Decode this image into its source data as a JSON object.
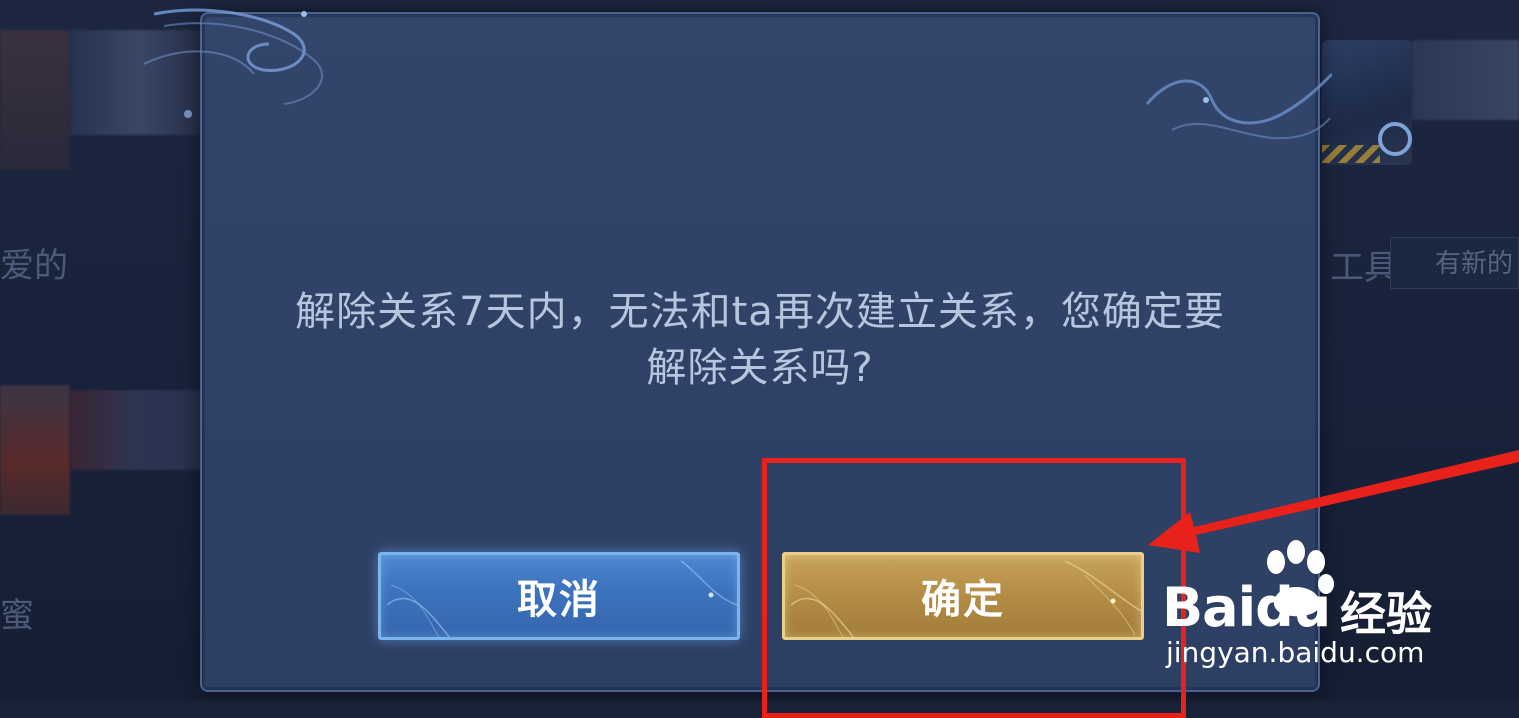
{
  "background": {
    "left_texts": [
      "爱的",
      "蜜"
    ],
    "right_text": "工具",
    "right_badge": "有新的"
  },
  "dialog": {
    "message_line1": "解除关系7天内，无法和ta再次建立关系，您确定要",
    "message_line2": "解除关系吗?",
    "cancel_label": "取消",
    "confirm_label": "确定"
  },
  "watermark": {
    "brand": "Baidu",
    "product": "经验",
    "url": "jingyan.baidu.com"
  },
  "colors": {
    "annotation_red": "#e8211b",
    "cancel_blue": "#3c72bd",
    "confirm_gold": "#b48c45"
  }
}
